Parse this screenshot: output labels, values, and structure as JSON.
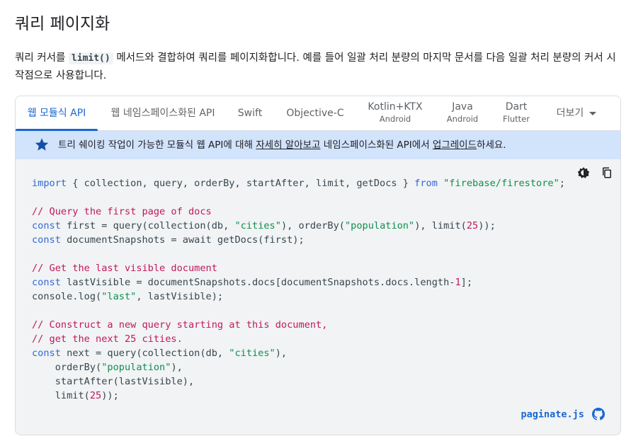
{
  "page": {
    "title": "쿼리 페이지화",
    "intro": {
      "text_before": "쿼리 커서를 ",
      "code": "limit()",
      "text_after": " 메서드와 결합하여 쿼리를 페이지화합니다. 예를 들어 일괄 처리 분량의 마지막 문서를 다음 일괄 처리 분량의 커서 시작점으로 사용합니다."
    }
  },
  "tabs": [
    {
      "label": "웹 모듈식 API",
      "sub": "",
      "active": true
    },
    {
      "label": "웹 네임스페이스화된 API",
      "sub": ""
    },
    {
      "label": "Swift",
      "sub": ""
    },
    {
      "label": "Objective-C",
      "sub": ""
    },
    {
      "label": "Kotlin+KTX",
      "sub": "Android"
    },
    {
      "label": "Java",
      "sub": "Android"
    },
    {
      "label": "Dart",
      "sub": "Flutter"
    },
    {
      "label": "더보기",
      "sub": ""
    }
  ],
  "banner": {
    "icon": "star-icon",
    "text_before": "트리 쉐이킹 작업이 가능한 모듈식 웹 API에 대해 ",
    "link1": "자세히 알아보고",
    "text_middle": " 네임스페이스화된 API에서 ",
    "link2": "업그레이드",
    "text_after": "하세요."
  },
  "code": {
    "filename": "paginate.js",
    "lines": [
      [
        [
          "kw",
          "import"
        ],
        [
          "p",
          " { collection, query, orderBy, startAfter, limit, getDocs } "
        ],
        [
          "kw",
          "from"
        ],
        [
          "p",
          " "
        ],
        [
          "str",
          "\"firebase/firestore\""
        ],
        [
          "p",
          ";"
        ]
      ],
      [],
      [
        [
          "cm",
          "// Query the first page of docs"
        ]
      ],
      [
        [
          "kw",
          "const"
        ],
        [
          "p",
          " first = query(collection(db, "
        ],
        [
          "str",
          "\"cities\""
        ],
        [
          "p",
          "), orderBy("
        ],
        [
          "str",
          "\"population\""
        ],
        [
          "p",
          "), limit("
        ],
        [
          "num",
          "25"
        ],
        [
          "p",
          "));"
        ]
      ],
      [
        [
          "kw",
          "const"
        ],
        [
          "p",
          " documentSnapshots = await getDocs(first);"
        ]
      ],
      [],
      [
        [
          "cm",
          "// Get the last visible document"
        ]
      ],
      [
        [
          "kw",
          "const"
        ],
        [
          "p",
          " lastVisible = documentSnapshots.docs[documentSnapshots.docs.length-"
        ],
        [
          "num",
          "1"
        ],
        [
          "p",
          "];"
        ]
      ],
      [
        [
          "p",
          "console.log("
        ],
        [
          "str",
          "\"last\""
        ],
        [
          "p",
          ", lastVisible);"
        ]
      ],
      [],
      [
        [
          "cm",
          "// Construct a new query starting at this document,"
        ]
      ],
      [
        [
          "cm",
          "// get the next 25 cities."
        ]
      ],
      [
        [
          "kw",
          "const"
        ],
        [
          "p",
          " next = query(collection(db, "
        ],
        [
          "str",
          "\"cities\""
        ],
        [
          "p",
          "),"
        ]
      ],
      [
        [
          "p",
          "    orderBy("
        ],
        [
          "str",
          "\"population\""
        ],
        [
          "p",
          "),"
        ]
      ],
      [
        [
          "p",
          "    startAfter(lastVisible),"
        ]
      ],
      [
        [
          "p",
          "    limit("
        ],
        [
          "num",
          "25"
        ],
        [
          "p",
          "));"
        ]
      ]
    ]
  },
  "colors": {
    "accent": "#1967d2",
    "banner_bg": "#d2e3fc",
    "code_bg": "#f1f3f4",
    "keyword": "#3367d6",
    "string": "#0d904f",
    "comment": "#c2185b"
  },
  "icons": {
    "theme_toggle": "dark-mode-icon",
    "copy": "copy-icon",
    "github": "github-icon",
    "more": "chevron-down-icon"
  }
}
